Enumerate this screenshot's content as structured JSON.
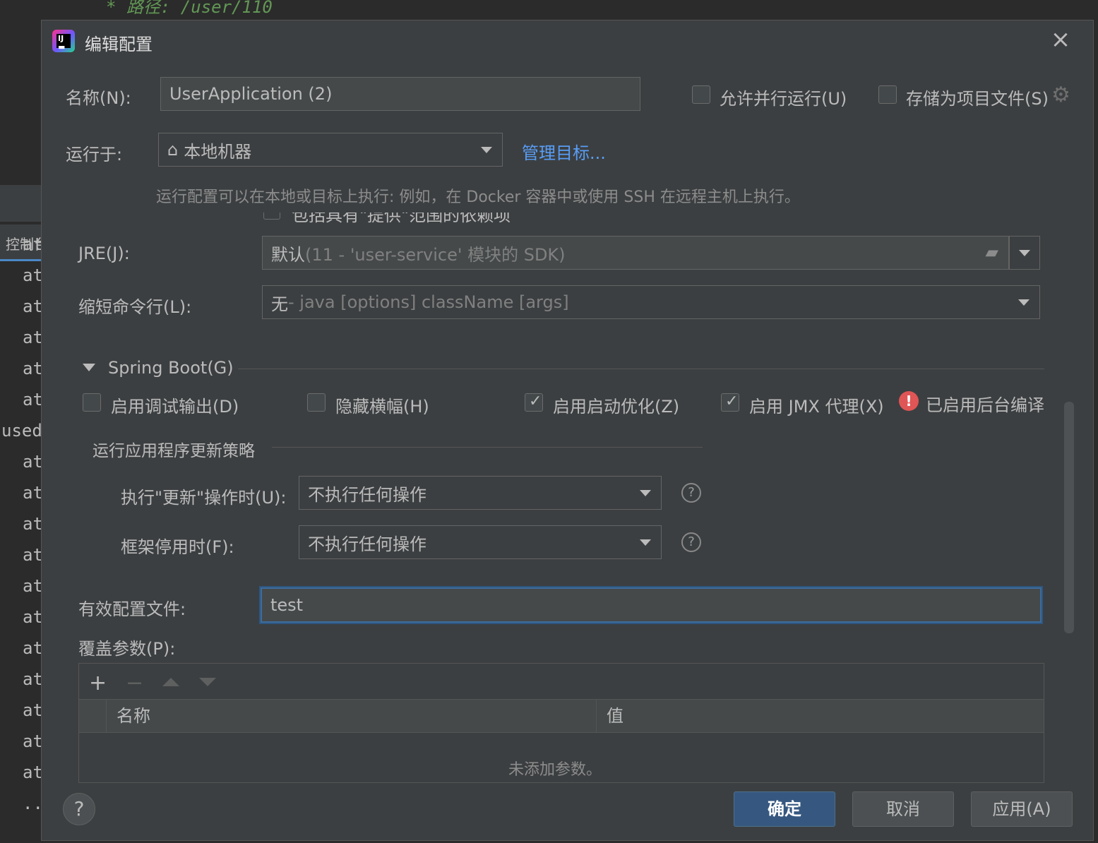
{
  "background": {
    "code_line": "* 路径: /user/110",
    "console_tab": "控制台",
    "console_lines": [
      "at",
      "at",
      "at",
      "at",
      "at",
      "at",
      "used",
      "at",
      "at",
      "at",
      "at",
      "at",
      "at",
      "at",
      "at",
      "at",
      "at",
      "at",
      "..."
    ]
  },
  "dialog": {
    "title": "编辑配置",
    "app_icon": "intellij-idea-icon",
    "close_icon": "close-icon"
  },
  "name_row": {
    "label": "名称(N):",
    "value": "UserApplication (2)",
    "allow_parallel": {
      "label": "允许并行运行(U)",
      "checked": false
    },
    "store_as_file": {
      "label": "存储为项目文件(S)",
      "checked": false
    }
  },
  "run_on": {
    "label": "运行于:",
    "value": "本地机器",
    "manage_link": "管理目标...",
    "hint": "运行配置可以在本地或目标上执行: 例如，在 Docker 容器中或使用 SSH 在远程主机上执行。",
    "cut_text": "包括具有\"提供\"范围的依赖项"
  },
  "jre": {
    "label": "JRE(J):",
    "value_main": "默认",
    "value_detail": " (11 - 'user-service' 模块的 SDK)"
  },
  "shorten": {
    "label": "缩短命令行(L):",
    "value_main": "无",
    "value_detail": " - java [options] className [args]"
  },
  "spring_boot": {
    "section_title": "Spring Boot(G)",
    "options": [
      {
        "label": "启用调试输出(D)",
        "checked": false
      },
      {
        "label": "隐藏横幅(H)",
        "checked": false
      },
      {
        "label": "启用启动优化(Z)",
        "checked": true
      },
      {
        "label": "启用 JMX 代理(X)",
        "checked": true
      }
    ],
    "background_compile": "已启用后台编译",
    "update_policy_title": "运行应用程序更新策略",
    "on_update_label": "执行\"更新\"操作时(U):",
    "on_update_value": "不执行任何操作",
    "on_frame_label": "框架停用时(F):",
    "on_frame_value": "不执行任何操作",
    "active_profiles_label": "有效配置文件:",
    "active_profiles_value": "test",
    "override_params_label": "覆盖参数(P):",
    "table": {
      "col_name": "名称",
      "col_value": "值",
      "empty_text": "未添加参数。"
    }
  },
  "footer": {
    "ok": "确定",
    "cancel": "取消",
    "apply": "应用(A)",
    "help": "?"
  },
  "colors": {
    "dialog_bg": "#3c3f41",
    "link": "#589df6",
    "primary_button": "#365880",
    "focus_border": "#3d6c9c",
    "error": "#e05555"
  }
}
